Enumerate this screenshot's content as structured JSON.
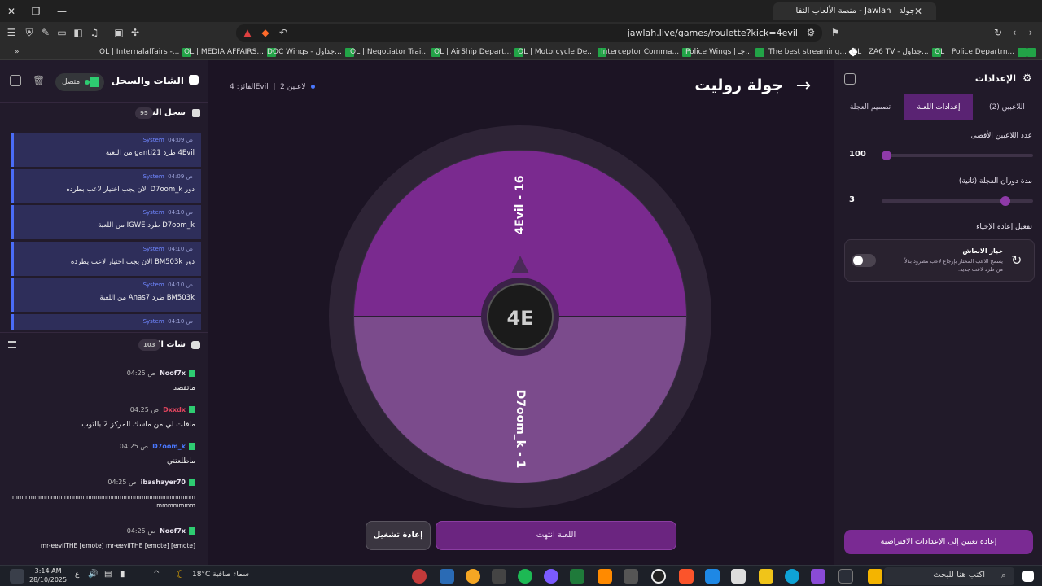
{
  "browser": {
    "tab_title": "جولة | Jawlah - منصة الألعاب التفا",
    "url": "jawlah.live/games/roulette?kick=4evil"
  },
  "bookmarks": [
    "OL | Internalaffairs -...",
    "OL | MEDIA AFFAIRS...",
    "DOC Wings - جداول...",
    "OL | Negotiator Trai...",
    "OL | AirShip Depart...",
    "OL | Motorcycle De...",
    "Interceptor Comma...",
    "Police Wings | جـ...",
    "The best streaming...",
    "OL | ZA6 TV - جداول...",
    "OL | Police Departm..."
  ],
  "chat": {
    "title": "الشات والسجل",
    "status": "متصل",
    "system_log": {
      "title": "سجل النظام",
      "count": "95"
    },
    "system_messages": [
      {
        "sender": "System",
        "time": "04:09 ص",
        "text": "4Evil طرد ganti21 من اللعبة"
      },
      {
        "sender": "System",
        "time": "04:09 ص",
        "text": "دور D7oom_k الان يجب اختيار لاعب بطرده"
      },
      {
        "sender": "System",
        "time": "04:10 ص",
        "text": "D7oom_k طرد IGWE من اللعبة"
      },
      {
        "sender": "System",
        "time": "04:10 ص",
        "text": "دور BM503k الان يجب اختيار لاعب يطرده"
      },
      {
        "sender": "System",
        "time": "04:10 ص",
        "text": "BM503k طرد Anas7 من اللعبة"
      },
      {
        "sender": "System",
        "time": "04:10 ص",
        "text": ""
      }
    ],
    "live_chat": {
      "title": "شات البث",
      "count": "103"
    },
    "messages": [
      {
        "user": "Noof7x",
        "time": "04:25 ص",
        "text": "ماتقصد",
        "color": "#e8e3ee"
      },
      {
        "user": "Dxxdx",
        "time": "04:25 ص",
        "text": "ماقلت لي من ماسك المركز 2 بالتوب",
        "color": "#e0455e"
      },
      {
        "user": "D7oom_k",
        "time": "04:25 ص",
        "text": "ماطلعتني",
        "color": "#4a78ff"
      },
      {
        "user": "ibashayer70",
        "time": "04:25 ص",
        "text": "mmmmmmmmmmmmmmmmmmmmmmmmmmmmmmmmmmmmmmmm",
        "color": "#e8e3ee"
      },
      {
        "user": "Noof7x",
        "time": "04:25 ص",
        "text": "[emote] mr-eevilTHE [emote] mr-eevilTHE [emote]",
        "color": "#e8e3ee"
      }
    ]
  },
  "game": {
    "title": "جولة روليت",
    "players_label": "2 لاعبين",
    "winner_label": "الفائز: 4Evil",
    "wheel": {
      "segments": [
        {
          "label": "4Evil - 16",
          "color": "#7a2a8f"
        },
        {
          "label": "D7oom_k - 1",
          "color": "#7b4b8c"
        }
      ],
      "center_logo": "4E"
    },
    "game_over_label": "اللعبة انتهت",
    "restart_label": "إعادة تشغيل"
  },
  "settings": {
    "title": "الإعدادات",
    "tabs": [
      {
        "label": "اللاعبين (2)",
        "active": false
      },
      {
        "label": "إعدادات اللعبة",
        "active": true
      },
      {
        "label": "تصميم العجلة",
        "active": false
      }
    ],
    "max_players": {
      "label": "عدد اللاعبين الأقصى",
      "value": 100
    },
    "spin_duration": {
      "label": "مدة دوران العجلة (ثانية)",
      "value": 3
    },
    "revive_section_label": "تفعيل إعادة الإحياء",
    "revive": {
      "title": "خيار الانعاش",
      "description": "يسمح للاعب المختار بإرجاع لاعب مطرود بدلاً من طرد لاعب جديد.",
      "enabled": false
    },
    "reset_label": "إعادة تعيين إلى الإعدادات الافتراضية"
  },
  "taskbar": {
    "time": "3:14 AM",
    "date": "28/10/2025",
    "weather": "18°C  سماء صافية",
    "search_placeholder": "اكتب هنا للبحث"
  }
}
